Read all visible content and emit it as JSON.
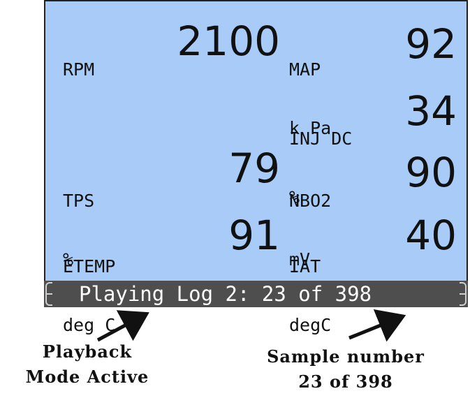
{
  "display": {
    "rpm": {
      "label": "RPM",
      "unit": "",
      "value": "2100"
    },
    "map": {
      "label": "MAP",
      "unit": "k Pa",
      "value": "92"
    },
    "inj": {
      "label": "INJ DC",
      "unit": "%",
      "value": "34"
    },
    "tps": {
      "label": "TPS",
      "unit": "%",
      "value": "79"
    },
    "nbo2": {
      "label": "NBO2",
      "unit": "mV",
      "value": "90"
    },
    "etemp": {
      "label": "ETEMP",
      "unit": "deg C",
      "value": "91"
    },
    "iat": {
      "label": "IAT",
      "unit": "degC",
      "value": "40"
    }
  },
  "status_bar": {
    "text": "Playing Log 2: 23 of 398"
  },
  "annotations": {
    "playback": {
      "line1": "Playback",
      "line2": "Mode Active"
    },
    "sample": {
      "line1": "Sample number",
      "line2": "23 of 398"
    }
  },
  "colors": {
    "screen_bg": "#a9cbf7",
    "status_bg": "#4e4e4e",
    "status_text": "#ffffff"
  }
}
